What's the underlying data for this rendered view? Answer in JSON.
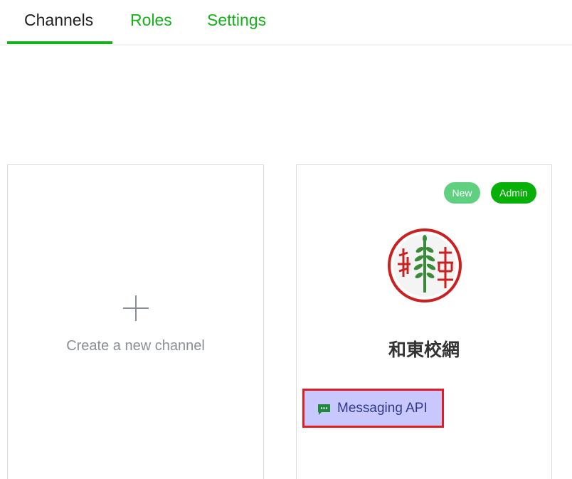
{
  "tabs": [
    {
      "label": "Channels",
      "active": true
    },
    {
      "label": "Roles",
      "active": false
    },
    {
      "label": "Settings",
      "active": false
    }
  ],
  "create_card": {
    "icon": "plus-icon",
    "label": "Create a new channel"
  },
  "channel_card": {
    "badges": {
      "new": "New",
      "admin": "Admin"
    },
    "name": "和東校網",
    "type_label": "Messaging API",
    "type_icon": "chat-bubble-icon"
  },
  "colors": {
    "accent_green": "#15b01a",
    "badge_new": "#5fcf80",
    "badge_admin": "#06b006",
    "highlight_border": "#e31b23",
    "highlight_fill": "#c8c8ff"
  }
}
